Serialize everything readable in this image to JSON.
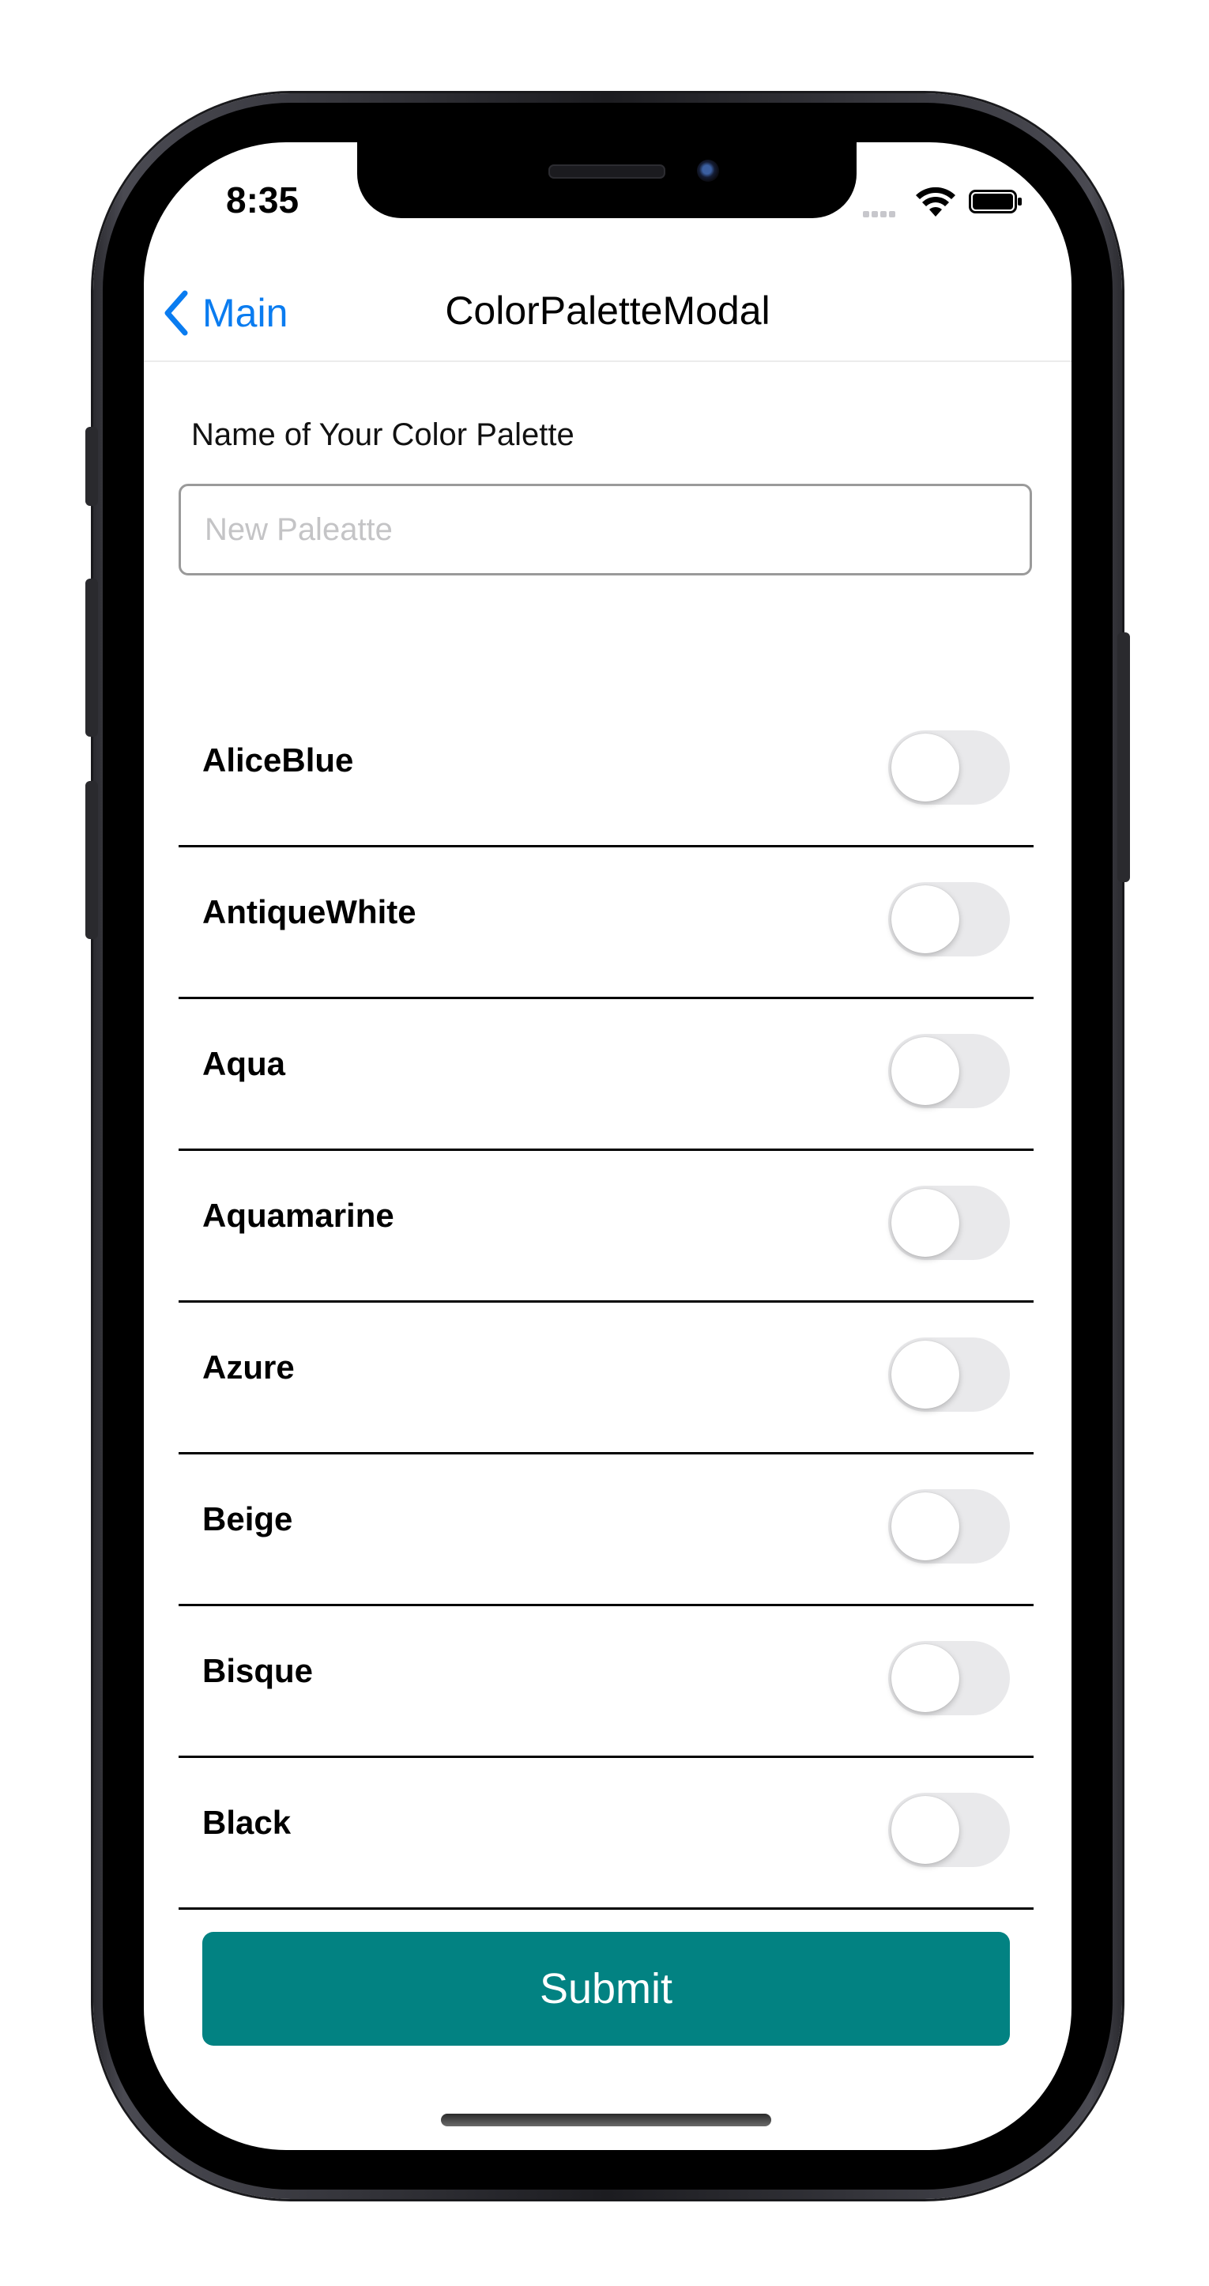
{
  "status_bar": {
    "time": "8:35"
  },
  "nav": {
    "back_label": "Main",
    "title": "ColorPaletteModal"
  },
  "form": {
    "label": "Name of Your Color Palette",
    "input_value": "",
    "input_placeholder": "New Paleatte"
  },
  "colors": [
    {
      "name": "AliceBlue",
      "enabled": false
    },
    {
      "name": "AntiqueWhite",
      "enabled": false
    },
    {
      "name": "Aqua",
      "enabled": false
    },
    {
      "name": "Aquamarine",
      "enabled": false
    },
    {
      "name": "Azure",
      "enabled": false
    },
    {
      "name": "Beige",
      "enabled": false
    },
    {
      "name": "Bisque",
      "enabled": false
    },
    {
      "name": "Black",
      "enabled": false
    }
  ],
  "submit_label": "Submit",
  "theme": {
    "accent": "#0a7cf0",
    "button": "#028282",
    "toggle_off": "#e9e9eb"
  }
}
